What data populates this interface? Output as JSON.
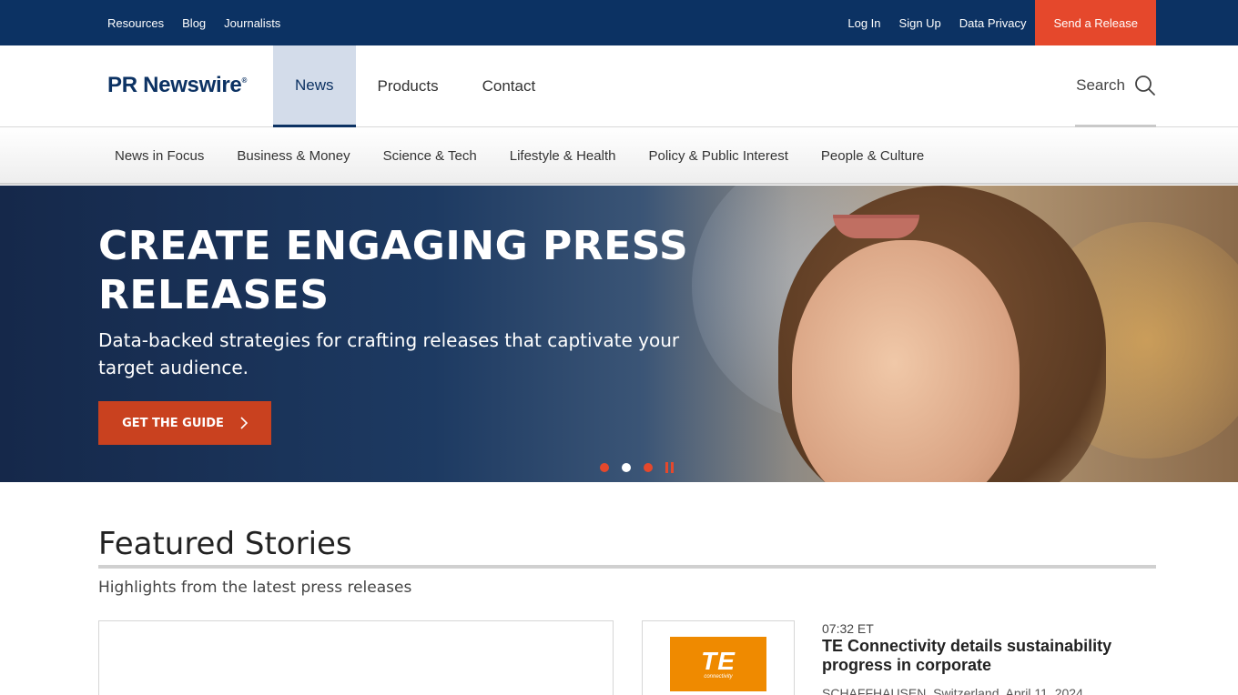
{
  "utility": {
    "left_links": [
      "Resources",
      "Blog",
      "Journalists"
    ],
    "login": "Log In",
    "signup": "Sign Up",
    "privacy": "Data Privacy",
    "send_release": "Send a Release"
  },
  "header": {
    "logo": "PR Newswire",
    "logo_mark": "®",
    "nav": [
      "News",
      "Products",
      "Contact"
    ],
    "active_nav": "News",
    "search_label": "Search"
  },
  "categories": [
    "News in Focus",
    "Business & Money",
    "Science & Tech",
    "Lifestyle & Health",
    "Policy & Public Interest",
    "People & Culture"
  ],
  "hero": {
    "title": "CREATE ENGAGING PRESS RELEASES",
    "subtitle": "Data-backed strategies for crafting releases that captivate your target audience.",
    "cta": "GET THE GUIDE",
    "slide_count": 3,
    "active_slide": 2
  },
  "featured": {
    "title": "Featured Stories",
    "subtitle": "Highlights from the latest press releases",
    "story": {
      "time": "07:32 ET",
      "title": "TE Connectivity details sustainability progress in corporate",
      "dateline": "SCHAFFHAUSEN, Switzerland, April 11, 2024",
      "logo_text": "TE",
      "logo_sub": "connectivity"
    }
  },
  "colors": {
    "brand_navy": "#0c3263",
    "accent_orange": "#e5482c",
    "cta_orange": "#c9411f",
    "te_orange": "#ef8a00"
  }
}
